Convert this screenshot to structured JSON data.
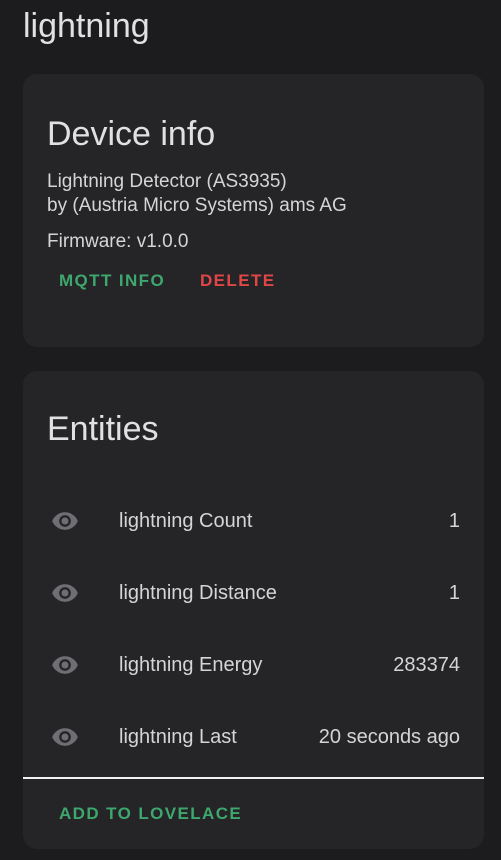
{
  "page": {
    "title": "lightning"
  },
  "device_info": {
    "title": "Device info",
    "model": "Lightning Detector (AS3935)",
    "manufacturer": "by (Austria Micro Systems) ams AG",
    "firmware": "Firmware: v1.0.0",
    "buttons": {
      "mqtt_info": "MQTT INFO",
      "delete": "DELETE"
    }
  },
  "entities": {
    "title": "Entities",
    "items": [
      {
        "icon": "eye-icon",
        "name": "lightning Count",
        "value": "1"
      },
      {
        "icon": "eye-icon",
        "name": "lightning Distance",
        "value": "1"
      },
      {
        "icon": "eye-icon",
        "name": "lightning Energy",
        "value": "283374"
      },
      {
        "icon": "eye-icon",
        "name": "lightning Last",
        "value": "20 seconds ago"
      }
    ],
    "add_button": "ADD TO LOVELACE"
  },
  "colors": {
    "background": "#1c1c1e",
    "card": "#252528",
    "accent_green": "#3ea76e",
    "danger_red": "#e04646",
    "icon_gray": "#6f6f73"
  }
}
